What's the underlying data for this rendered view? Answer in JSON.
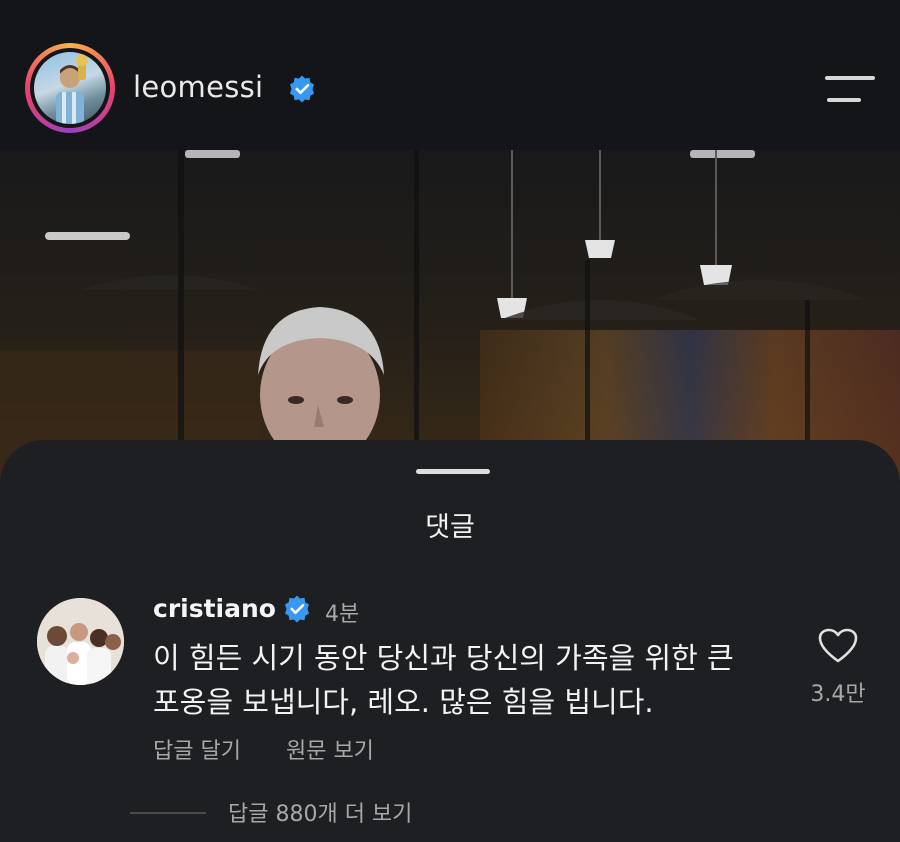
{
  "header": {
    "username": "leomessi",
    "verified_icon": "verified-badge-icon",
    "menu_icon": "hamburger-menu-icon"
  },
  "sheet": {
    "title": "댓글"
  },
  "comment": {
    "username": "cristiano",
    "time": "4분",
    "text_lines": [
      "이 힘든 시기 동안 당신과 당신의 가족을 위한 큰",
      "포옹을 보냅니다, 레오. 많은 힘을 빕니다."
    ],
    "reply_label": "답글 달기",
    "translate_label": "원문 보기",
    "like_count": "3.4만",
    "view_replies_label": "답글 880개 더 보기"
  },
  "colors": {
    "background": "#121212",
    "sheet": "#1e1f22",
    "verified": "#3897f0",
    "secondary_text": "#a8a8a8"
  }
}
